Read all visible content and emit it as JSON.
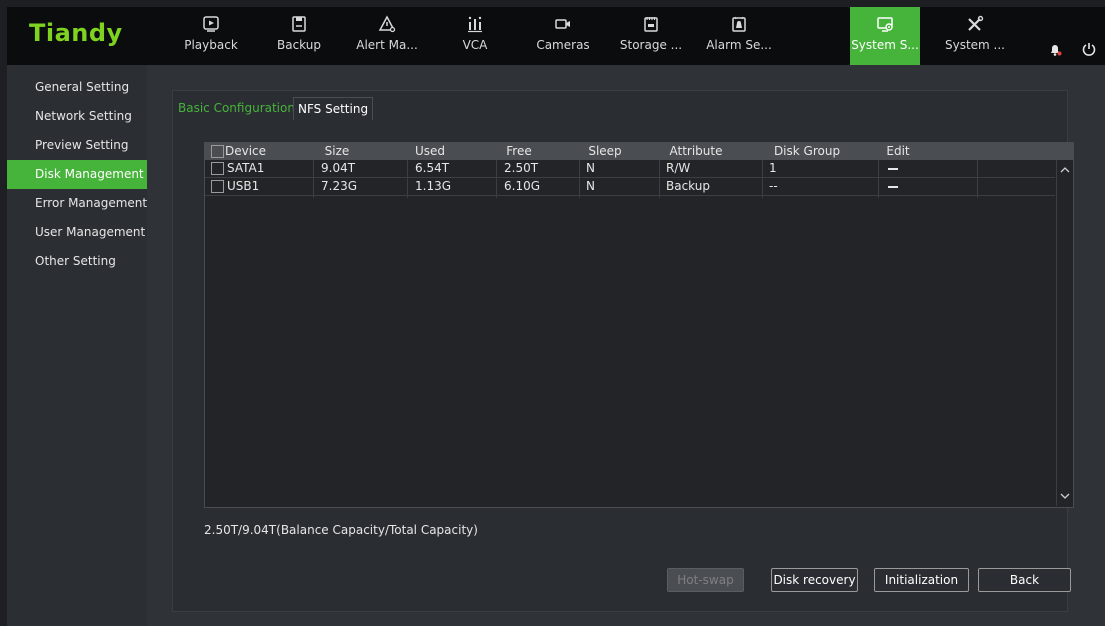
{
  "brand": {
    "logo_text": "Tiandy",
    "accent": "#46b33b"
  },
  "nav": {
    "items": [
      {
        "label": "Playback",
        "icon": "playback-icon"
      },
      {
        "label": "Backup",
        "icon": "backup-icon"
      },
      {
        "label": "Alert Ma...",
        "icon": "alert-icon"
      },
      {
        "label": "VCA",
        "icon": "vca-icon"
      },
      {
        "label": "Cameras",
        "icon": "camera-icon"
      },
      {
        "label": "Storage ...",
        "icon": "storage-icon"
      },
      {
        "label": "Alarm Se...",
        "icon": "alarm-icon"
      },
      {
        "label": "System S...",
        "icon": "system-settings-icon",
        "active": true
      },
      {
        "label": "System ...",
        "icon": "system-tools-icon"
      }
    ],
    "right_icons": [
      "bell-icon",
      "power-icon"
    ]
  },
  "sidebar": {
    "items": [
      {
        "label": "General Setting"
      },
      {
        "label": "Network Setting"
      },
      {
        "label": "Preview Setting"
      },
      {
        "label": "Disk Management",
        "active": true
      },
      {
        "label": "Error Management"
      },
      {
        "label": "User Management"
      },
      {
        "label": "Other Setting"
      }
    ]
  },
  "tabs": [
    {
      "label": "Basic Configuration",
      "active": true
    },
    {
      "label": "NFS Setting",
      "active": false
    }
  ],
  "table": {
    "headers": [
      "Device",
      "Size",
      "Used",
      "Free",
      "Sleep",
      "Attribute",
      "Disk Group",
      "Edit"
    ],
    "rows": [
      {
        "device": "SATA1",
        "size": "9.04T",
        "used": "6.54T",
        "free": "2.50T",
        "sleep": "N",
        "attribute": "R/W",
        "disk_group": "1",
        "edit": "—"
      },
      {
        "device": "USB1",
        "size": "7.23G",
        "used": "1.13G",
        "free": "6.10G",
        "sleep": "N",
        "attribute": "Backup",
        "disk_group": "--",
        "edit": "—"
      }
    ]
  },
  "capacity_text": "2.50T/9.04T(Balance Capacity/Total Capacity)",
  "buttons": {
    "hotswap": "Hot-swap",
    "disk_recovery": "Disk recovery",
    "initialization": "Initialization",
    "back": "Back"
  }
}
